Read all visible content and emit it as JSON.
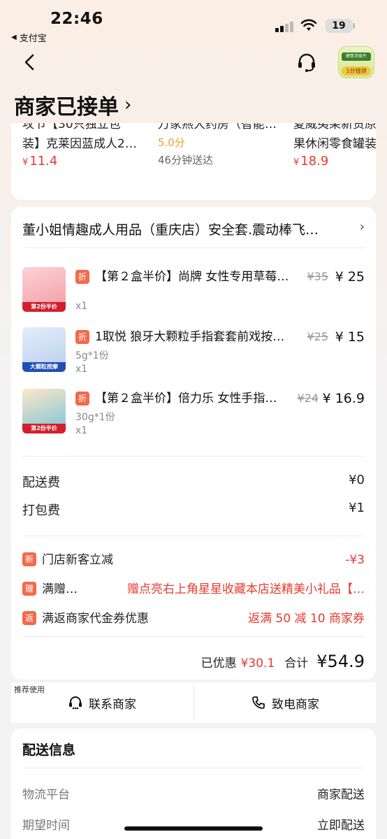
{
  "status_bar": {
    "time": "22:46",
    "back_app": "支付宝",
    "battery": "19"
  },
  "nav": {
    "promo_top": "健胃消食片",
    "promo_bottom": "1分钱领"
  },
  "page_title": "商家已接单",
  "recommendations": [
    {
      "line1": "攻节【30只独立包",
      "line2": "装】克莱因蓝成人2…",
      "price": "11.4"
    },
    {
      "line1": "万家燕大药房（智能…",
      "score": "5.0分",
      "delivery": "46分钟送达"
    },
    {
      "line1": "夏威夷果新货原",
      "line2": "果休闲零食罐装",
      "price": "18.9"
    }
  ],
  "currency_symbol": "¥",
  "order": {
    "shop_name": "董小姐情趣成人用品（重庆店）安全套.震动棒飞…",
    "items": [
      {
        "tag": "折",
        "name": "【第２盒半价】尚牌 女性专用草莓…",
        "orig_price": "¥35",
        "price": "¥ 25",
        "spec": "",
        "qty": "x1",
        "thumb_label": "第2份半价"
      },
      {
        "tag": "折",
        "name": "1取悦 狼牙大颗粒手指套套前戏按…",
        "orig_price": "¥25",
        "price": "¥ 15",
        "spec": "5g*1份",
        "qty": "x1",
        "thumb_label": "大颗粒按摩"
      },
      {
        "tag": "折",
        "name": "【第２盒半价】倍力乐 女性手指…",
        "orig_price": "¥24",
        "price": "¥ 16.9",
        "spec": "30g*1份",
        "qty": "x1",
        "thumb_label": "第2份半价"
      }
    ],
    "fees": [
      {
        "label": "配送费",
        "value": "¥0"
      },
      {
        "label": "打包费",
        "value": "¥1"
      }
    ],
    "discounts": [
      {
        "icon": "新",
        "label": "门店新客立减",
        "value": "-¥3"
      },
      {
        "icon": "赠",
        "label": "满赠…",
        "value": "赠点亮右上角星星收藏本店送精美小礼品【…"
      },
      {
        "icon": "返",
        "label": "满返商家代金券优惠",
        "value": "返满 50 减 10 商家券"
      }
    ],
    "saved_label": "已优惠",
    "saved_value": "¥30.1",
    "total_label": "合计",
    "total_value": "¥54.9"
  },
  "actions": {
    "recommend_tag": "推荐使用",
    "contact": "联系商家",
    "call": "致电商家"
  },
  "delivery": {
    "title": "配送信息",
    "rows": [
      {
        "key": "物流平台",
        "value": "商家配送"
      },
      {
        "key": "期望时间",
        "value": "立即配送"
      }
    ]
  },
  "colors": {
    "accent_red": "#e83a2f",
    "discount_orange": "#f26a4b",
    "score_orange": "#f0a020"
  }
}
